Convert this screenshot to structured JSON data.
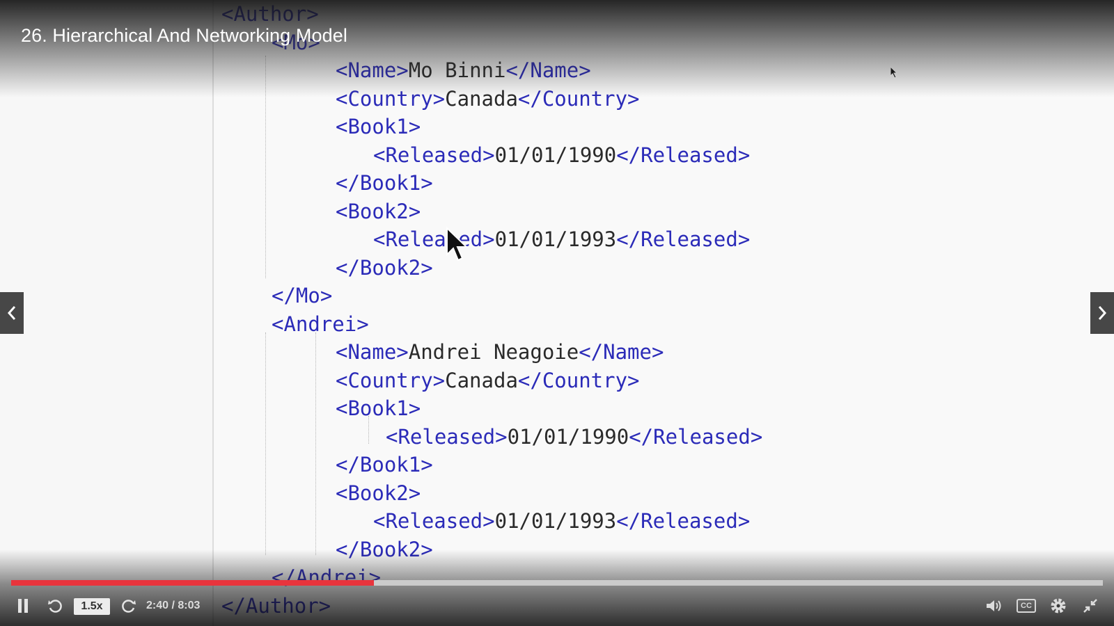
{
  "video": {
    "title": "26. Hierarchical And Networking Model"
  },
  "code_lines": [
    {
      "indent": "top",
      "parts": [
        {
          "t": "tag",
          "v": "<Author>"
        }
      ]
    },
    {
      "indent": "l1",
      "parts": [
        {
          "t": "tag",
          "v": "<Mo>"
        }
      ]
    },
    {
      "indent": "l2",
      "parts": [
        {
          "t": "tag",
          "v": "<Name>"
        },
        {
          "t": "txt",
          "v": "Mo Binni"
        },
        {
          "t": "tag",
          "v": "</Name>"
        }
      ]
    },
    {
      "indent": "l2",
      "parts": [
        {
          "t": "tag",
          "v": "<Country>"
        },
        {
          "t": "txt",
          "v": "Canada"
        },
        {
          "t": "tag",
          "v": "</Country>"
        }
      ]
    },
    {
      "indent": "l2",
      "parts": [
        {
          "t": "tag",
          "v": "<Book1>"
        }
      ]
    },
    {
      "indent": "l3",
      "parts": [
        {
          "t": "tag",
          "v": "<Released>"
        },
        {
          "t": "txt",
          "v": "01/01/1990"
        },
        {
          "t": "tag",
          "v": "</Released>"
        }
      ]
    },
    {
      "indent": "l2",
      "parts": [
        {
          "t": "tag",
          "v": "</Book1>"
        }
      ]
    },
    {
      "indent": "l2",
      "parts": [
        {
          "t": "tag",
          "v": "<Book2>"
        }
      ]
    },
    {
      "indent": "l3",
      "parts": [
        {
          "t": "tag",
          "v": "<Released>"
        },
        {
          "t": "txt",
          "v": "01/01/1993"
        },
        {
          "t": "tag",
          "v": "</Released>"
        }
      ]
    },
    {
      "indent": "l2",
      "parts": [
        {
          "t": "tag",
          "v": "</Book2>"
        }
      ]
    },
    {
      "indent": "l1",
      "parts": [
        {
          "t": "tag",
          "v": "</Mo>"
        }
      ]
    },
    {
      "indent": "l1",
      "parts": [
        {
          "t": "tag",
          "v": "<Andrei>"
        }
      ]
    },
    {
      "indent": "l2",
      "parts": [
        {
          "t": "tag",
          "v": "<Name>"
        },
        {
          "t": "txt",
          "v": "Andrei Neagoie"
        },
        {
          "t": "tag",
          "v": "</Name>"
        }
      ]
    },
    {
      "indent": "l2",
      "parts": [
        {
          "t": "tag",
          "v": "<Country>"
        },
        {
          "t": "txt",
          "v": "Canada"
        },
        {
          "t": "tag",
          "v": "</Country>"
        }
      ]
    },
    {
      "indent": "l2",
      "parts": [
        {
          "t": "tag",
          "v": "<Book1>"
        }
      ]
    },
    {
      "indent": "l3b",
      "parts": [
        {
          "t": "tag",
          "v": "<Released>"
        },
        {
          "t": "txt",
          "v": "01/01/1990"
        },
        {
          "t": "tag",
          "v": "</Released>"
        }
      ]
    },
    {
      "indent": "l2",
      "parts": [
        {
          "t": "tag",
          "v": "</Book1>"
        }
      ]
    },
    {
      "indent": "l2",
      "parts": [
        {
          "t": "tag",
          "v": "<Book2>"
        }
      ]
    },
    {
      "indent": "l3",
      "parts": [
        {
          "t": "tag",
          "v": "<Released>"
        },
        {
          "t": "txt",
          "v": "01/01/1993"
        },
        {
          "t": "tag",
          "v": "</Released>"
        }
      ]
    },
    {
      "indent": "l2",
      "parts": [
        {
          "t": "tag",
          "v": "</Book2>"
        }
      ]
    },
    {
      "indent": "l1",
      "parts": [
        {
          "t": "tag",
          "v": "</Andrei>"
        }
      ]
    },
    {
      "indent": "top",
      "parts": [
        {
          "t": "tag",
          "v": "</Author>"
        }
      ]
    }
  ],
  "player": {
    "speed_label": "1.5x",
    "time_current": "2:40",
    "time_total": "8:03",
    "time_display": "2:40 / 8:03",
    "progress_fraction": 0.332,
    "cc_label": "CC",
    "progress_color": "#e8343c"
  },
  "icons": {
    "pause": "pause-icon",
    "rewind": "rewind-icon",
    "forward": "forward-icon",
    "volume": "volume-icon",
    "captions": "captions-icon",
    "settings": "gear-icon",
    "fullscreen": "exit-fullscreen-icon",
    "prev": "chevron-left-icon",
    "next": "chevron-right-icon"
  }
}
